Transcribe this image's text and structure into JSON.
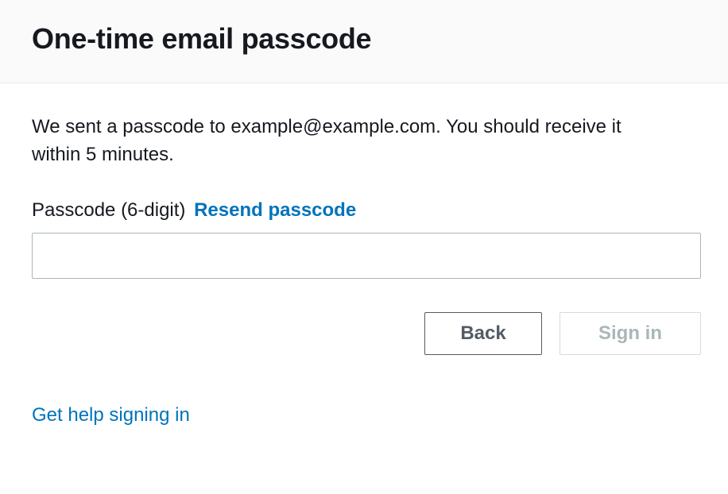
{
  "header": {
    "title": "One-time email passcode"
  },
  "description": "We sent a passcode to example@example.com. You should receive it within 5 minutes.",
  "field": {
    "label": "Passcode (6-digit)",
    "resend_label": "Resend passcode",
    "value": ""
  },
  "buttons": {
    "back": "Back",
    "signin": "Sign in"
  },
  "help_link": "Get help signing in"
}
